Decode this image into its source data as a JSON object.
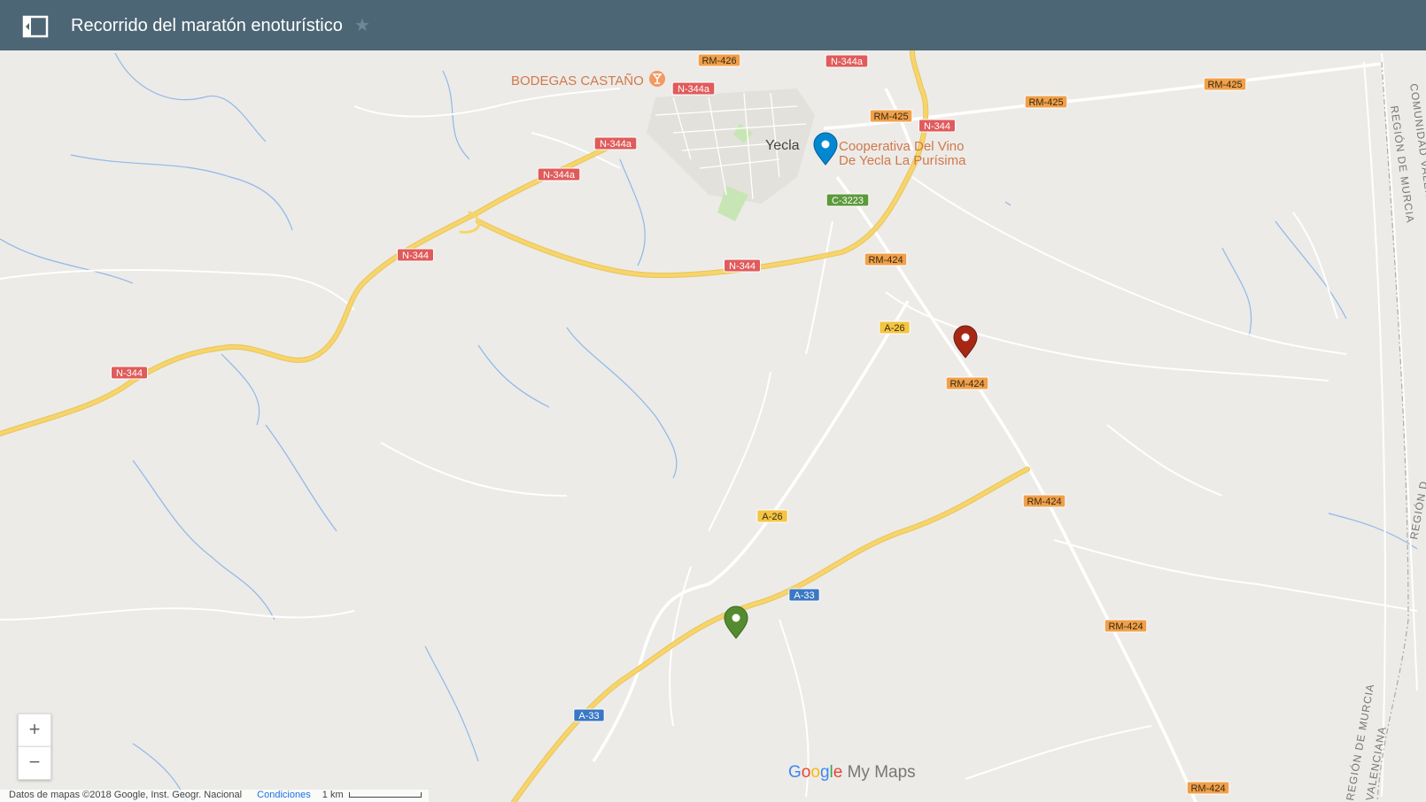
{
  "header": {
    "title": "Recorrido del maratón enoturístico",
    "star_icon": "star-icon",
    "toggle_icon": "sidebar-toggle-icon"
  },
  "map": {
    "town": "Yecla",
    "poi_winery": "BODEGAS CASTAÑO",
    "poi_coop_line1": "Cooperativa Del Vino",
    "poi_coop_line2": "De Yecla La Purísima",
    "region_1": "COMUNIDAD VALEN",
    "region_2": "REGIÓN DE MURCIA",
    "region_3": "REGIÓN D",
    "region_4": "REGIÓN DE MURCIA",
    "region_5": "VALENCIANA",
    "shields": [
      {
        "text": "RM-426",
        "kind": "regional"
      },
      {
        "text": "N-344a",
        "kind": "national"
      },
      {
        "text": "N-344a",
        "kind": "national"
      },
      {
        "text": "RM-425",
        "kind": "regional"
      },
      {
        "text": "N-344",
        "kind": "national"
      },
      {
        "text": "RM-425",
        "kind": "regional"
      },
      {
        "text": "RM-425",
        "kind": "regional"
      },
      {
        "text": "N-344a",
        "kind": "national"
      },
      {
        "text": "N-344a",
        "kind": "national"
      },
      {
        "text": "C-3223",
        "kind": "local"
      },
      {
        "text": "N-344",
        "kind": "national"
      },
      {
        "text": "N-344",
        "kind": "national"
      },
      {
        "text": "RM-424",
        "kind": "regional"
      },
      {
        "text": "A-26",
        "kind": "autovia"
      },
      {
        "text": "RM-424",
        "kind": "regional"
      },
      {
        "text": "N-344",
        "kind": "national"
      },
      {
        "text": "RM-424",
        "kind": "regional"
      },
      {
        "text": "A-26",
        "kind": "autovia"
      },
      {
        "text": "A-33",
        "kind": "motorway"
      },
      {
        "text": "RM-424",
        "kind": "regional"
      },
      {
        "text": "A-33",
        "kind": "motorway"
      },
      {
        "text": "RM-424",
        "kind": "regional"
      }
    ],
    "markers": [
      {
        "name": "Cooperativa Del Vino De Yecla La Purísima",
        "color": "#0288d1"
      },
      {
        "name": "red-marker",
        "color": "#a52714"
      },
      {
        "name": "green-marker",
        "color": "#558b2f"
      }
    ]
  },
  "controls": {
    "zoom_in": "+",
    "zoom_out": "−"
  },
  "footer": {
    "attribution": "Datos de mapas ©2018 Google, Inst. Geogr. Nacional",
    "terms": "Condiciones",
    "scale": "1 km"
  },
  "branding": {
    "google": "Google",
    "product": "My Maps"
  },
  "colors": {
    "header_bg": "#4d6675",
    "map_bg": "#ecebe8",
    "major_road": "#f7d56b",
    "national_shield": "#e05b5b",
    "regional_shield": "#f0a04b",
    "autovia_shield": "#f4c542",
    "motorway_shield": "#3b78c4",
    "local_shield": "#5c9a3b",
    "water": "#8fb8e8"
  }
}
